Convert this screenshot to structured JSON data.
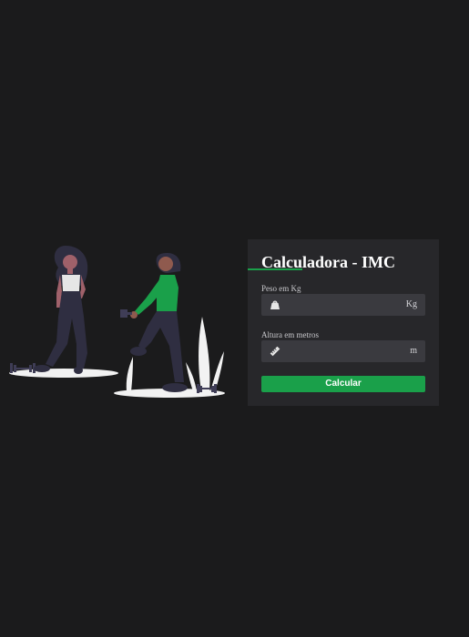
{
  "card": {
    "title": "Calculadora - IMC",
    "peso": {
      "label": "Peso em Kg",
      "value": "",
      "unit": "Kg",
      "icon": "weight-icon"
    },
    "altura": {
      "label": "Altura em metros",
      "value": "",
      "unit": "m",
      "icon": "ruler-icon"
    },
    "button_label": "Calcular"
  },
  "colors": {
    "background": "#1b1b1c",
    "card": "#27272a",
    "input": "#3a3a3f",
    "accent": "#1aa04a",
    "text": "#ffffff"
  }
}
